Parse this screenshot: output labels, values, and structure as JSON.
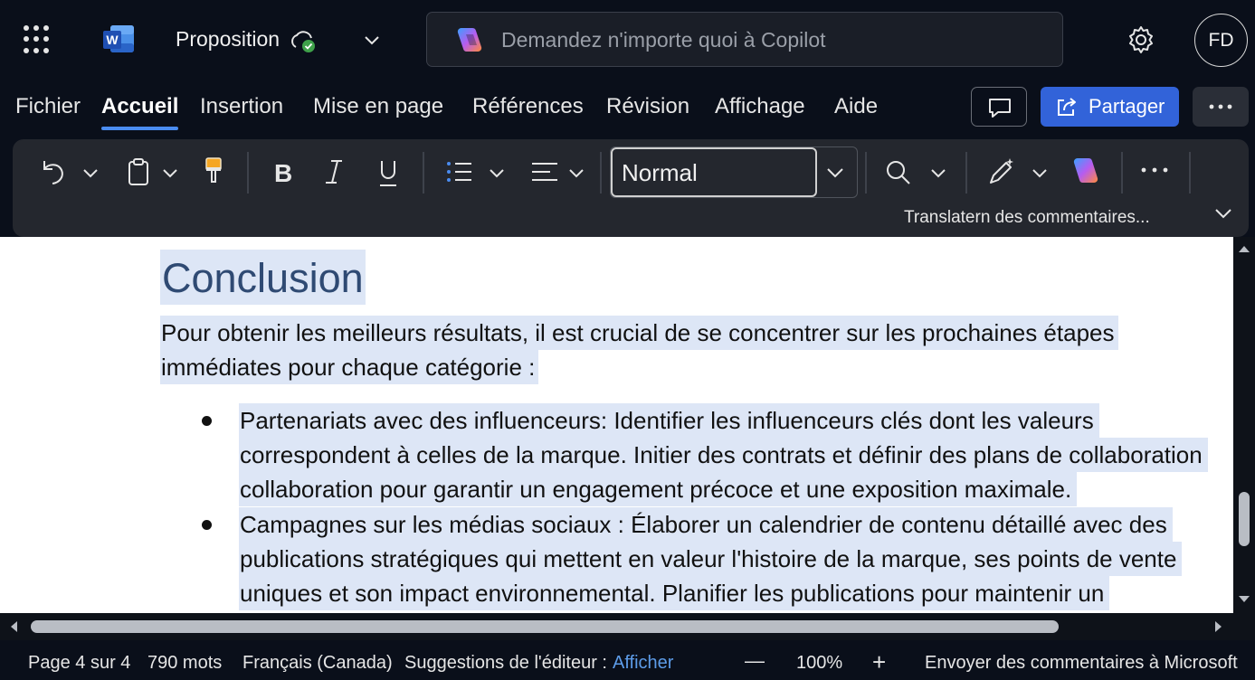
{
  "titlebar": {
    "app_icon": "word-logo-icon",
    "app_letter": "W",
    "doc_title": "Proposition",
    "save_status_icon": "cloud-saved-icon",
    "copilot_placeholder": "Demandez n'importe quoi à Copilot",
    "settings_icon": "gear-icon",
    "avatar_initials": "FD"
  },
  "menu": {
    "tabs": [
      {
        "label": "Fichier"
      },
      {
        "label": "Accueil",
        "active": true
      },
      {
        "label": "Insertion"
      },
      {
        "label": "Mise en page"
      },
      {
        "label": "Références"
      },
      {
        "label": "Révision"
      },
      {
        "label": "Affichage"
      },
      {
        "label": "Aide"
      }
    ],
    "share_label": "Partager"
  },
  "ribbon": {
    "style_value": "Normal",
    "translate_label": "Translatern des commentaires..."
  },
  "document": {
    "heading": "Conclusion",
    "intro_lines": [
      "Pour obtenir les meilleurs résultats, il est crucial de se concentrer sur les prochaines étapes",
      "immédiates pour chaque catégorie :"
    ],
    "bullets": [
      {
        "lines": [
          "Partenariats avec des influenceurs: Identifier les influenceurs clés dont les valeurs",
          "correspondent à celles de la marque. Initier des contrats et définir des plans de collaboration",
          "collaboration pour garantir un engagement précoce et une exposition maximale."
        ]
      },
      {
        "lines": [
          "Campagnes sur les médias sociaux : Élaborer un calendrier de contenu détaillé avec des",
          "publications stratégiques qui mettent en valeur l'histoire de la marque, ses points de vente",
          "uniques et son impact environnemental. Planifier les publications pour maintenir un"
        ]
      }
    ]
  },
  "status": {
    "page": "Page 4 sur 4",
    "words": "790 mots",
    "language": "Français (Canada)",
    "editor_suggestions": "Suggestions de l'éditeur :",
    "editor_link": "Afficher",
    "zoom_minus": "—",
    "zoom": "100%",
    "zoom_plus": "+",
    "feedback": "Envoyer des commentaires à Microsoft"
  },
  "colors": {
    "accent": "#3263d9",
    "selection": "#dde6f6",
    "heading": "#2f4a73",
    "background": "#0a0f1a",
    "ribbon": "#24272e",
    "link": "#5d9ce8"
  }
}
